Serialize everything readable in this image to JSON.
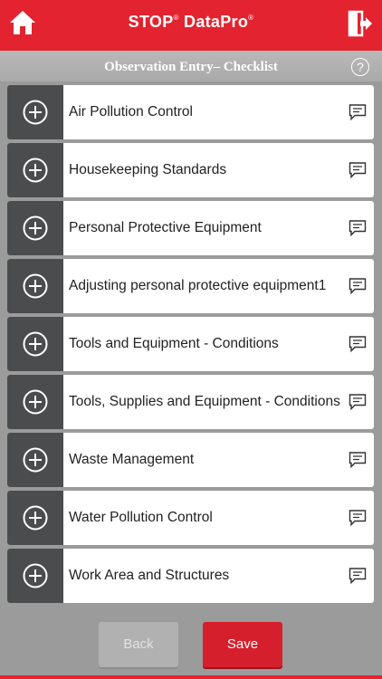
{
  "header": {
    "brand": "STOP",
    "brand_suffix": "DataPro",
    "home_icon": "home-icon",
    "logout_icon": "logout-icon"
  },
  "subheader": {
    "title": "Observation Entry– Checklist",
    "help_icon": "?"
  },
  "checklist": {
    "items": [
      {
        "label": "Air Pollution Control"
      },
      {
        "label": "Housekeeping Standards"
      },
      {
        "label": "Personal Protective Equipment"
      },
      {
        "label": "Adjusting personal protective equipment1"
      },
      {
        "label": "Tools and Equipment - Conditions"
      },
      {
        "label": "Tools, Supplies and Equipment - Conditions"
      },
      {
        "label": "Waste Management"
      },
      {
        "label": "Water Pollution Control"
      },
      {
        "label": "Work Area and Structures"
      }
    ]
  },
  "actions": {
    "back_label": "Back",
    "save_label": "Save"
  },
  "colors": {
    "accent": "#e3232f",
    "row_icon_bg": "#4b4c4e",
    "background": "#9b9b9b"
  }
}
